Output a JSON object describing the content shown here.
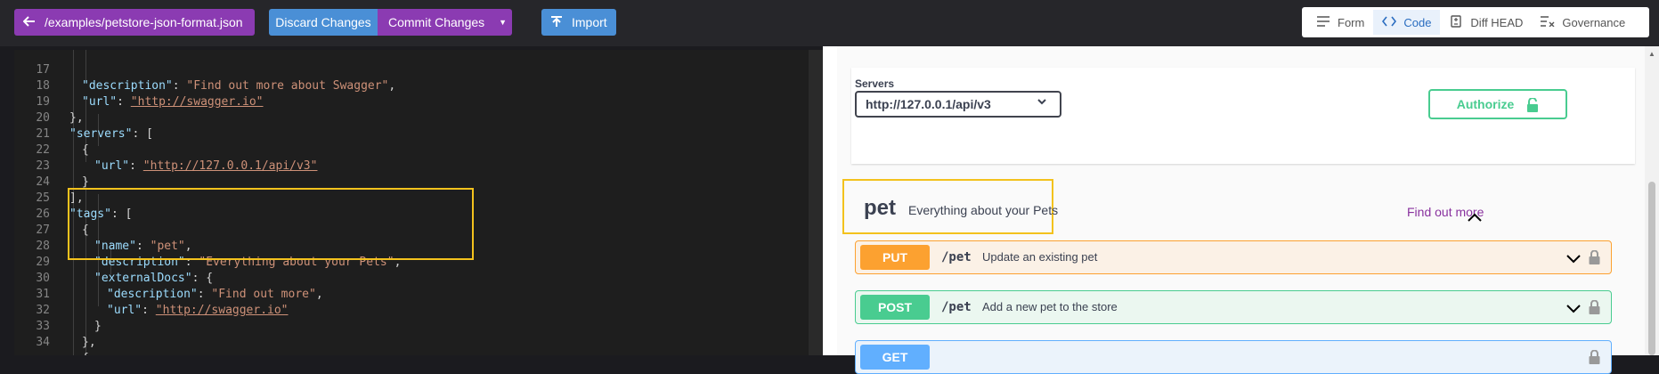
{
  "toolbar": {
    "path_label": "/examples/petstore-json-format.json",
    "discard_label": "Discard Changes",
    "commit_label": "Commit Changes",
    "import_label": "Import"
  },
  "tabs": [
    {
      "label": "Form",
      "icon": "form-lines-icon"
    },
    {
      "label": "Code",
      "icon": "code-brackets-icon"
    },
    {
      "label": "Diff HEAD",
      "icon": "diff-document-icon"
    },
    {
      "label": "Governance",
      "icon": "governance-check-icon"
    }
  ],
  "active_tab": "Code",
  "editor": {
    "lines": [
      {
        "n": "17",
        "indent": 2
      },
      {
        "n": "18",
        "indent": 2
      },
      {
        "n": "19",
        "indent": 1
      },
      {
        "n": "20",
        "indent": 1
      },
      {
        "n": "21",
        "indent": 2
      },
      {
        "n": "22",
        "indent": 3
      },
      {
        "n": "23",
        "indent": 2
      },
      {
        "n": "24",
        "indent": 1
      },
      {
        "n": "25",
        "indent": 1
      },
      {
        "n": "26",
        "indent": 2
      },
      {
        "n": "27",
        "indent": 3
      },
      {
        "n": "28",
        "indent": 3
      },
      {
        "n": "29",
        "indent": 3
      },
      {
        "n": "30",
        "indent": 4
      },
      {
        "n": "31",
        "indent": 4
      },
      {
        "n": "32",
        "indent": 3
      },
      {
        "n": "33",
        "indent": 2
      },
      {
        "n": "34",
        "indent": 2
      }
    ],
    "tokens": {
      "l17_key": "\"description\"",
      "l17_val": "\"Find out more about Swagger\"",
      "l18_key": "\"url\"",
      "l18_val": "\"http://swagger.io\"",
      "l19": "},",
      "l20_key": "\"servers\"",
      "l20_rest": ": [",
      "l21": "{",
      "l22_key": "\"url\"",
      "l22_val": "\"http://127.0.0.1/api/v3\"",
      "l23": "}",
      "l24": "],",
      "l25_key": "\"tags\"",
      "l25_rest": ": [",
      "l26": "{",
      "l27_key": "\"name\"",
      "l27_val": "\"pet\"",
      "l28_key": "\"description\"",
      "l28_val": "\"Everything about your Pets\"",
      "l29_key": "\"externalDocs\"",
      "l29_rest": ": {",
      "l30_key": "\"description\"",
      "l30_val": "\"Find out more\"",
      "l31_key": "\"url\"",
      "l31_val": "\"http://swagger.io\"",
      "l32": "}",
      "l33": "},",
      "l34": "{"
    }
  },
  "swagger": {
    "servers_label": "Servers",
    "server_selected": "http://127.0.0.1/api/v3",
    "authorize_label": "Authorize",
    "tag": {
      "name": "pet",
      "description": "Everything about your Pets",
      "find_more": "Find out more"
    },
    "operations": [
      {
        "method": "PUT",
        "path": "/pet",
        "summary": "Update an existing pet"
      },
      {
        "method": "POST",
        "path": "/pet",
        "summary": "Add a new pet to the store"
      },
      {
        "method": "GET",
        "path": "",
        "summary": ""
      }
    ]
  },
  "colors": {
    "accent_purple": "#8b3bb2",
    "accent_blue": "#4a8fd6",
    "highlight_yellow": "#f3c21d",
    "put_orange": "#fca130",
    "post_green": "#49cc90",
    "get_blue": "#61affe"
  }
}
